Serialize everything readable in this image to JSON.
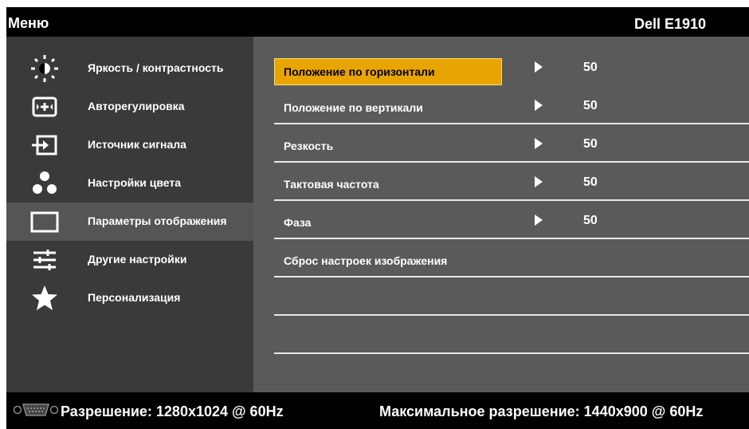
{
  "header": {
    "title": "Меню",
    "model": "Dell E1910"
  },
  "sidebar": {
    "items": [
      {
        "label": "Яркость / контрастность",
        "icon": "brightness-icon"
      },
      {
        "label": "Авторегулировка",
        "icon": "auto-adjust-icon"
      },
      {
        "label": "Источник сигнала",
        "icon": "input-source-icon"
      },
      {
        "label": "Настройки цвета",
        "icon": "color-dots-icon"
      },
      {
        "label": "Параметры отображения",
        "icon": "display-rectangle-icon",
        "selected": true
      },
      {
        "label": "Другие настройки",
        "icon": "sliders-icon"
      },
      {
        "label": "Персонализация",
        "icon": "star-icon"
      }
    ]
  },
  "content": {
    "rows": [
      {
        "label": "Положение по горизонтали",
        "value": "50",
        "selected": true
      },
      {
        "label": "Положение по вертикали",
        "value": "50"
      },
      {
        "label": "Резкость",
        "value": "50"
      },
      {
        "label": "Тактовая частота",
        "value": "50"
      },
      {
        "label": "Фаза",
        "value": "50"
      },
      {
        "label": "Сброс настроек изображения"
      },
      {
        "label": ""
      },
      {
        "label": ""
      }
    ]
  },
  "footer": {
    "resolution": "Разрешение: 1280x1024 @ 60Hz",
    "max_resolution": "Максимальное разрешение: 1440x900 @ 60Hz",
    "connector_icon": "vga-connector-icon"
  },
  "colors": {
    "highlight": "#e8a400",
    "sidebar_bg": "#3a3a3a",
    "content_bg": "#5a5a5a"
  }
}
